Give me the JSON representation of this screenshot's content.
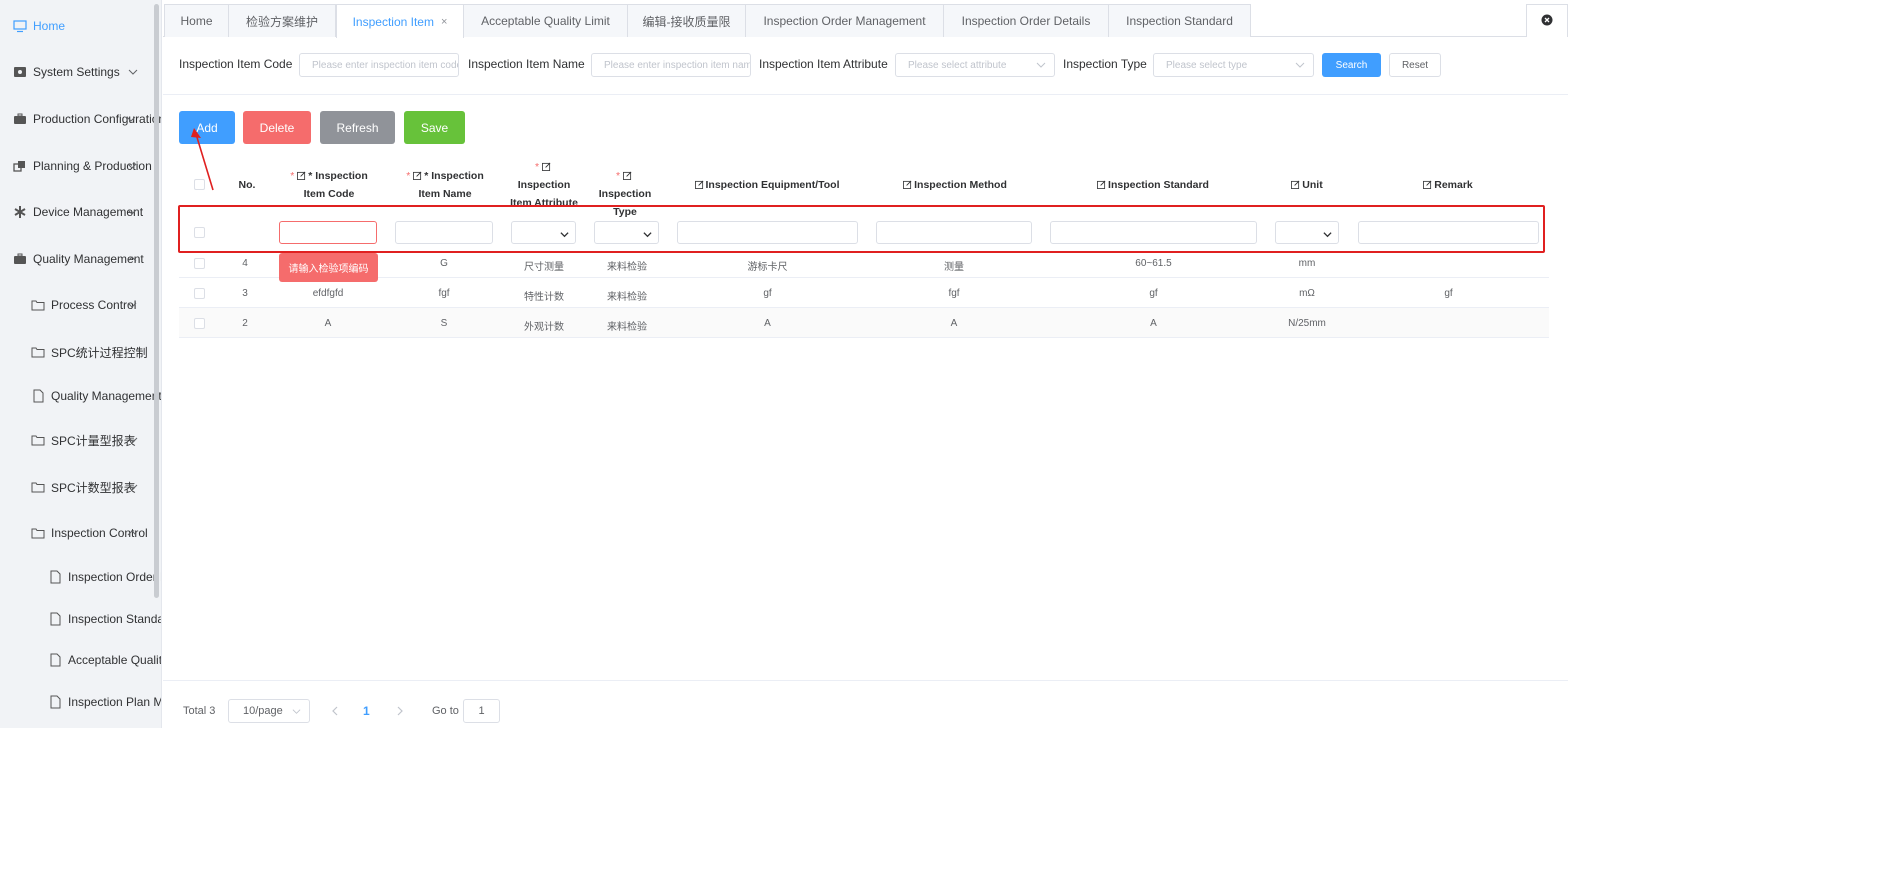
{
  "sidebar": {
    "items": [
      {
        "label": "Home",
        "icon": "monitor-icon"
      },
      {
        "label": "System Settings",
        "icon": "gear-box-icon"
      },
      {
        "label": "Production Configuration",
        "icon": "briefcase-icon"
      },
      {
        "label": "Planning & Production",
        "icon": "windows-icon"
      },
      {
        "label": "Device Management",
        "icon": "asterisk-icon"
      },
      {
        "label": "Quality Management",
        "icon": "briefcase-icon"
      },
      {
        "label": "Process Control",
        "icon": "folder-icon"
      },
      {
        "label": "SPC统计过程控制",
        "icon": "folder-icon"
      },
      {
        "label": "Quality Management Board",
        "icon": "document-icon"
      },
      {
        "label": "SPC计量型报表",
        "icon": "folder-icon"
      },
      {
        "label": "SPC计数型报表",
        "icon": "folder-icon"
      },
      {
        "label": "Inspection Control",
        "icon": "folder-icon"
      },
      {
        "label": "Inspection Order Management",
        "icon": "document-icon"
      },
      {
        "label": "Inspection Standard",
        "icon": "document-icon"
      },
      {
        "label": "Acceptable Quality Limit",
        "icon": "document-icon"
      },
      {
        "label": "Inspection Plan Maintenance",
        "icon": "document-icon"
      }
    ]
  },
  "tabs": [
    {
      "label": "Home"
    },
    {
      "label": "检验方案维护"
    },
    {
      "label": "Inspection Item",
      "active": true,
      "close": "×"
    },
    {
      "label": "Acceptable Quality Limit"
    },
    {
      "label": "编辑-接收质量限"
    },
    {
      "label": "Inspection Order Management"
    },
    {
      "label": "Inspection Order Details"
    },
    {
      "label": "Inspection Standard"
    }
  ],
  "search": {
    "code_label": "Inspection Item Code",
    "code_placeholder": "Please enter inspection item code",
    "name_label": "Inspection Item Name",
    "name_placeholder": "Please enter inspection item name",
    "attr_label": "Inspection Item Attribute",
    "attr_placeholder": "Please select attribute",
    "type_label": "Inspection Type",
    "type_placeholder": "Please select type",
    "search_label": "Search",
    "reset_label": "Reset"
  },
  "actions": {
    "add": "Add",
    "delete": "Delete",
    "refresh": "Refresh",
    "save": "Save",
    "colors": {
      "add": "#409eff",
      "delete": "#f56c6c",
      "refresh": "#909399",
      "save": "#67c23a"
    }
  },
  "table": {
    "headers": {
      "no": "No.",
      "code": "* Inspection Item Code",
      "name": "* Inspection Item Name",
      "attr": "Inspection Item Attribute",
      "type": "Inspection Type",
      "equipment": "Inspection Equipment/Tool",
      "method": "Inspection Method",
      "standard": "Inspection Standard",
      "unit": "Unit",
      "remark": "Remark"
    },
    "required_mark": "*",
    "rows": [
      {
        "no": "4",
        "code": "",
        "name": "G",
        "attr": "尺寸测量",
        "type": "来料检验",
        "equipment": "游标卡尺",
        "method": "测量",
        "standard": "60~61.5",
        "unit": "mm",
        "remark": ""
      },
      {
        "no": "3",
        "code": "efdfgfd",
        "name": "fgf",
        "attr": "特性计数",
        "type": "来料检验",
        "equipment": "gf",
        "method": "fgf",
        "standard": "gf",
        "unit": "mΩ",
        "remark": "gf"
      },
      {
        "no": "2",
        "code": "A",
        "name": "S",
        "attr": "外观计数",
        "type": "来料检验",
        "equipment": "A",
        "method": "A",
        "standard": "A",
        "unit": "N/25mm",
        "remark": ""
      }
    ],
    "validation_tooltip": "请输入检验项编码"
  },
  "pagination": {
    "total": "Total 3",
    "page_size": "10/page",
    "current_page": "1",
    "goto_label": "Go to",
    "goto_value": "1"
  }
}
